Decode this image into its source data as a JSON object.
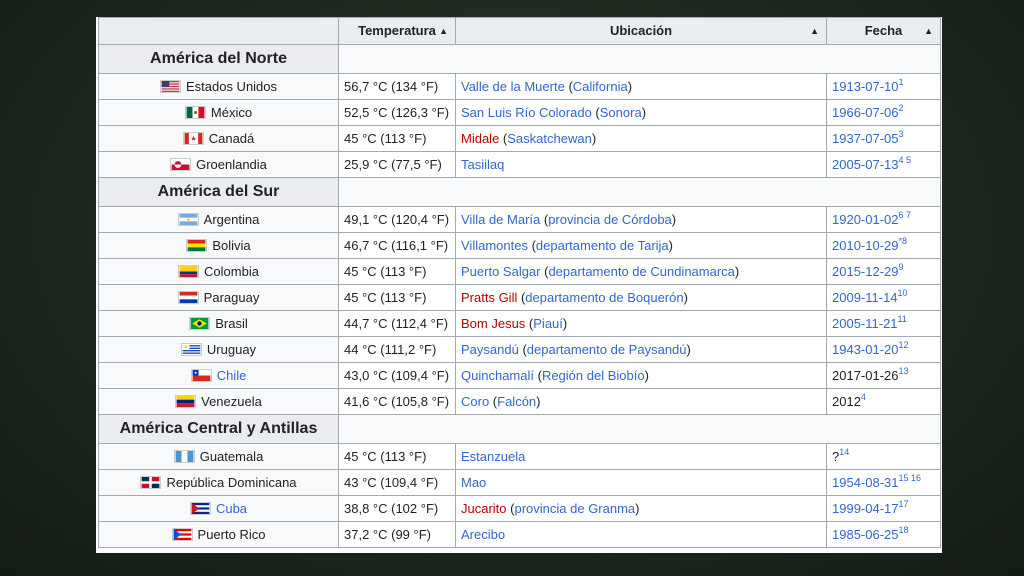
{
  "headers": {
    "country": "",
    "temperature": "Temperatura",
    "location": "Ubicación",
    "date": "Fecha"
  },
  "groups": [
    {
      "name": "América del Norte",
      "rows": [
        {
          "country": "Estados Unidos",
          "flag": "us-flag",
          "country_link": false,
          "temp": "56,7 °C (134 °F)",
          "place": "Valle de la Muerte",
          "place_red": false,
          "region_pre": " (",
          "region": "California",
          "region_post": ")",
          "date": "1913-07-10",
          "date_link": true,
          "refs": "1"
        },
        {
          "country": "México",
          "flag": "mexico-flag",
          "country_link": false,
          "temp": "52,5 °C (126,3 °F)",
          "place": "San Luis Río Colorado",
          "place_red": false,
          "region_pre": " (",
          "region": "Sonora",
          "region_post": ")",
          "date": "1966-07-06",
          "date_link": true,
          "refs": "2"
        },
        {
          "country": "Canadá",
          "flag": "canada-flag",
          "country_link": false,
          "temp": "45 °C (113 °F)",
          "place": "Midale",
          "place_red": true,
          "region_pre": " (",
          "region": "Saskatchewan",
          "region_post": ")",
          "date": "1937-07-05",
          "date_link": true,
          "refs": "3"
        },
        {
          "country": "Groenlandia",
          "flag": "greenland-flag",
          "country_link": false,
          "temp": "25,9 °C (77,5 °F)",
          "place": "Tasiilaq",
          "place_red": false,
          "region_pre": "",
          "region": "",
          "region_post": "",
          "date": "2005-07-13",
          "date_link": true,
          "refs": "4 5"
        }
      ]
    },
    {
      "name": "América del Sur",
      "rows": [
        {
          "country": "Argentina",
          "flag": "argentina-flag",
          "country_link": false,
          "temp": "49,1 °C (120,4 °F)",
          "place": "Villa de María",
          "place_red": false,
          "region_pre": " (",
          "region": "provincia de Córdoba",
          "region_post": ")",
          "date": "1920-01-02",
          "date_link": true,
          "refs": "6 7"
        },
        {
          "country": "Bolivia",
          "flag": "bolivia-flag",
          "country_link": false,
          "temp": "46,7 °C (116,1 °F)",
          "place": "Villamontes",
          "place_red": false,
          "region_pre": " (",
          "region": "departamento de Tarija",
          "region_post": ")",
          "date": "2010-10-29",
          "date_link": true,
          "refs": "*8"
        },
        {
          "country": "Colombia",
          "flag": "colombia-flag",
          "country_link": false,
          "temp": "45 °C (113 °F)",
          "place": "Puerto Salgar",
          "place_red": false,
          "region_pre": " (",
          "region": "departamento de Cundinamarca",
          "region_post": ")",
          "date": "2015-12-29",
          "date_link": true,
          "refs": "9"
        },
        {
          "country": "Paraguay",
          "flag": "paraguay-flag",
          "country_link": false,
          "temp": "45 °C (113 °F)",
          "place": "Pratts Gill",
          "place_red": true,
          "region_pre": " (",
          "region": "departamento de Boquerón",
          "region_post": ")",
          "date": "2009-11-14",
          "date_link": true,
          "refs": "10"
        },
        {
          "country": "Brasil",
          "flag": "brazil-flag",
          "country_link": false,
          "temp": "44,7 °C (112,4 °F)",
          "place": "Bom Jesus",
          "place_red": true,
          "region_pre": " (",
          "region": "Piauí",
          "region_post": ")",
          "date": "2005-11-21",
          "date_link": true,
          "refs": "11"
        },
        {
          "country": "Uruguay",
          "flag": "uruguay-flag",
          "country_link": false,
          "temp": "44 °C (111,2 °F)",
          "place": "Paysandú",
          "place_red": false,
          "region_pre": " (",
          "region": "departamento de Paysandú",
          "region_post": ")",
          "date": "1943-01-20",
          "date_link": true,
          "refs": "12"
        },
        {
          "country": "Chile",
          "flag": "chile-flag",
          "country_link": true,
          "temp": "43,0 °C (109,4 °F)",
          "place": "Quinchamalí",
          "place_red": false,
          "region_pre": " (",
          "region": "Región del Biobío",
          "region_post": ")",
          "date": "2017-01-26",
          "date_link": false,
          "refs": "13"
        },
        {
          "country": "Venezuela",
          "flag": "venezuela-flag",
          "country_link": false,
          "temp": "41,6 °C (105,8 °F)",
          "place": "Coro",
          "place_red": false,
          "region_pre": " (",
          "region": "Falcón",
          "region_post": ")",
          "date": "2012",
          "date_link": false,
          "refs": "4"
        }
      ]
    },
    {
      "name": "América Central y Antillas",
      "rows": [
        {
          "country": "Guatemala",
          "flag": "guatemala-flag",
          "country_link": false,
          "temp": "45 °C (113 °F)",
          "place": "Estanzuela",
          "place_red": false,
          "region_pre": "",
          "region": "",
          "region_post": "",
          "date": " ?",
          "date_link": false,
          "refs": "14"
        },
        {
          "country": "República Dominicana",
          "flag": "dominican-republic-flag",
          "country_link": false,
          "temp": "43 °C (109,4 °F)",
          "place": "Mao",
          "place_red": false,
          "region_pre": "",
          "region": "",
          "region_post": "",
          "date": "1954-08-31",
          "date_link": true,
          "refs": "15 16"
        },
        {
          "country": "Cuba",
          "flag": "cuba-flag",
          "country_link": true,
          "temp": "38,8 °C (102 °F)",
          "place": "Jucarito",
          "place_red": true,
          "region_pre": " (",
          "region": "provincia de Granma",
          "region_post": ")",
          "date": "1999-04-17",
          "date_link": true,
          "refs": "17"
        },
        {
          "country": "Puerto Rico",
          "flag": "puerto-rico-flag",
          "country_link": false,
          "temp": "37,2 °C (99 °F)",
          "place": "Arecibo",
          "place_red": false,
          "region_pre": "",
          "region": "",
          "region_post": "",
          "date": "1985-06-25",
          "date_link": true,
          "refs": "18"
        }
      ]
    }
  ],
  "colors": {
    "link": "#3366cc",
    "redlink": "#ba0000",
    "header_bg": "#eaecf0",
    "border": "#a2a9b1"
  }
}
